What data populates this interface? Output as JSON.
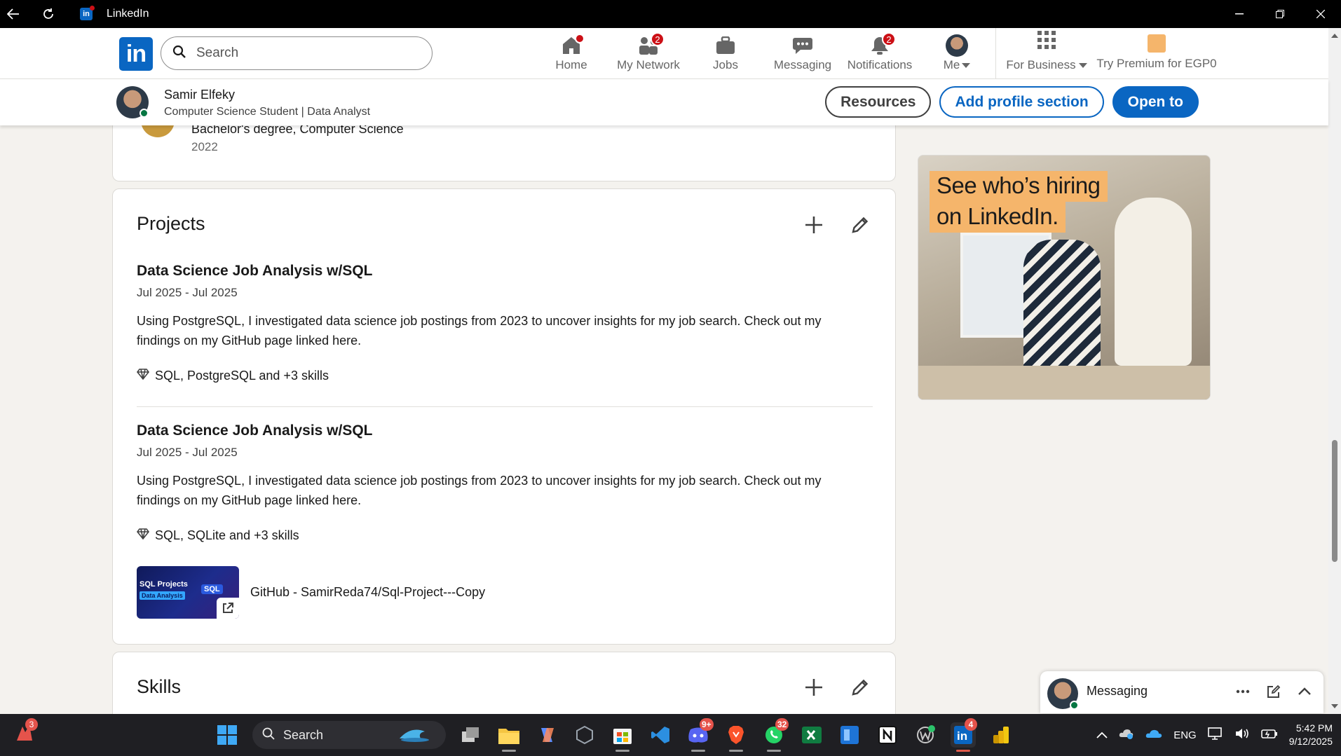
{
  "window": {
    "title": "LinkedIn"
  },
  "nav": {
    "logo_text": "in",
    "search_placeholder": "Search",
    "items": [
      {
        "label": "Home",
        "icon": "home-icon",
        "badge": ""
      },
      {
        "label": "My Network",
        "icon": "network-icon",
        "badge": "2"
      },
      {
        "label": "Jobs",
        "icon": "briefcase-icon",
        "badge": ""
      },
      {
        "label": "Messaging",
        "icon": "chat-icon",
        "badge": ""
      },
      {
        "label": "Notifications",
        "icon": "bell-icon",
        "badge": "2"
      },
      {
        "label": "Me",
        "icon": "avatar",
        "badge": ""
      }
    ],
    "for_business": "For Business",
    "premium": "Try Premium for EGP0"
  },
  "profile_bar": {
    "name": "Samir Elfeky",
    "headline": "Computer Science Student | Data Analyst",
    "buttons": {
      "resources": "Resources",
      "add_section": "Add profile section",
      "open_to": "Open to"
    }
  },
  "education": {
    "degree": "Bachelor's degree, Computer Science",
    "year": "2022"
  },
  "projects": {
    "title": "Projects",
    "items": [
      {
        "title": "Data Science Job Analysis w/SQL",
        "dates": "Jul 2025 - Jul 2025",
        "description": "Using PostgreSQL, I investigated data science job postings from 2023 to uncover insights for my job search. Check out my findings on my GitHub page linked here.",
        "skills": "SQL, PostgreSQL and +3 skills"
      },
      {
        "title": "Data Science Job Analysis w/SQL",
        "dates": "Jul 2025 - Jul 2025",
        "description": "Using PostgreSQL, I investigated data science job postings from 2023 to uncover insights for my job search. Check out my findings on my GitHub page linked here.",
        "skills": "SQL, SQLite and +3 skills",
        "media": {
          "thumb_line1": "SQL Projects",
          "thumb_line2": "Data Analysis",
          "thumb_line3": "SQL",
          "label": "GitHub - SamirReda74/Sql-Project---Copy"
        }
      }
    ]
  },
  "skills": {
    "title": "Skills"
  },
  "ad": {
    "line1": "See who’s hiring",
    "line2": "on LinkedIn."
  },
  "messaging": {
    "label": "Messaging"
  },
  "taskbar": {
    "search_placeholder": "Search",
    "left_badge": "3",
    "discord_badge": "9+",
    "whatsapp_badge": "32",
    "linkedin_badge": "4",
    "language": "ENG",
    "time": "5:42 PM",
    "date": "9/12/2025"
  },
  "colors": {
    "brand": "#0a66c2",
    "badge": "#cc1016",
    "online": "#057642",
    "ad_highlight": "#f5b56b"
  }
}
